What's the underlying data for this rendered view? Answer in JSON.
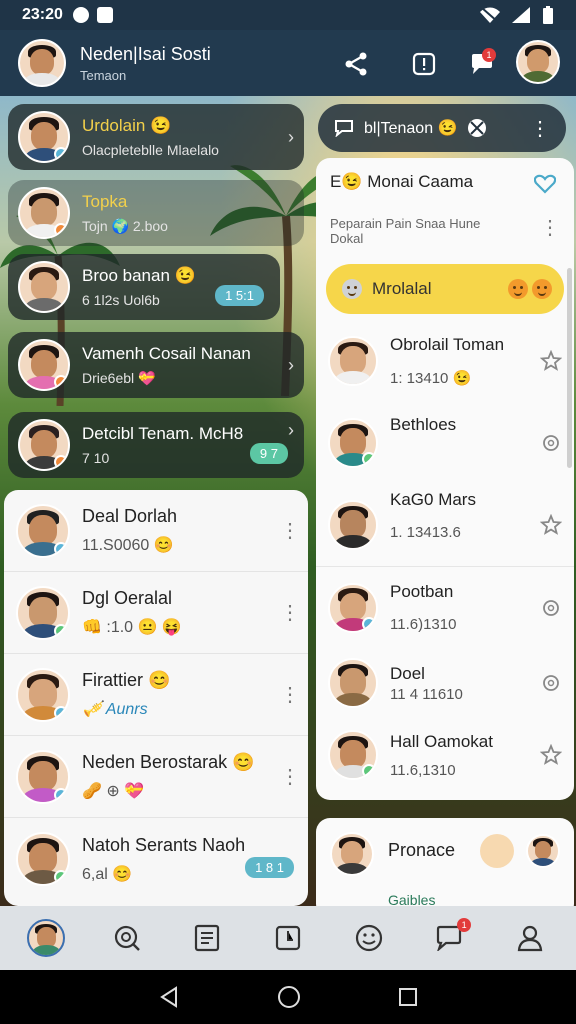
{
  "status_bar": {
    "time": "23:20"
  },
  "header": {
    "title": "Neden|Isai Sosti",
    "subtitle": "Temaon",
    "chat_badge": "1"
  },
  "left_stories": [
    {
      "name": "Urdolain 😉",
      "sub": "Olacpleteblle Mlaelalo",
      "count": ""
    },
    {
      "name": "Topka",
      "sub": "Tojn 🌍 2.boo",
      "count": ""
    },
    {
      "name": "Broo banan 😉",
      "sub": "6 1l2s Uol6b",
      "count": "1 5:1"
    },
    {
      "name": "Vamenh Cosail Nanan",
      "sub": "Drie6ebl 💝",
      "count": ""
    },
    {
      "name": "Detcibl Tenam. McH8",
      "sub": "7 10",
      "count": "9 7"
    }
  ],
  "left_card": [
    {
      "name": "Deal Dorlah",
      "sub": "11.S0060 😊",
      "count": ""
    },
    {
      "name": "Dgl Oeralal",
      "sub": "👊 :1.0 😐 😝",
      "count": ""
    },
    {
      "name": "Firattier 😊",
      "sub": "🎺 Aunrs",
      "count": ""
    },
    {
      "name": "Neden Berostarak 😊",
      "sub": "🥜 ⊕ 💝",
      "count": ""
    },
    {
      "name": "Natoh Serants Naoh",
      "sub": "6,al 😊",
      "count": "1 8 1"
    }
  ],
  "right_pill": {
    "label": "bl|Tenaon 😉"
  },
  "right_card": {
    "title": "Monai Caama",
    "prefix": "E😉",
    "desc": "Peparain Pain Snaa Hune Dokal",
    "yellow_label": "Mrolalal",
    "contacts": [
      {
        "name": "Obrolail Toman",
        "sub": "1: 13410 😉"
      },
      {
        "name": "Bethloes",
        "sub": ""
      },
      {
        "name": "KaG0 Mars",
        "sub": "1. 13413.6"
      },
      {
        "name": "Pootban",
        "sub": "11.6)1310"
      },
      {
        "name": "Doel",
        "sub": "11 4 11610"
      },
      {
        "name": "Hall Oamokat",
        "sub": "11.6,1310"
      }
    ]
  },
  "bottom_right_card": {
    "name": "Pronace",
    "sub": "Gaibles"
  },
  "colors": {
    "header_bg": "#223a4f",
    "accent_yellow": "#f6d64a",
    "accent_teal": "#5fb7c9",
    "notif_red": "#e23b3b"
  }
}
